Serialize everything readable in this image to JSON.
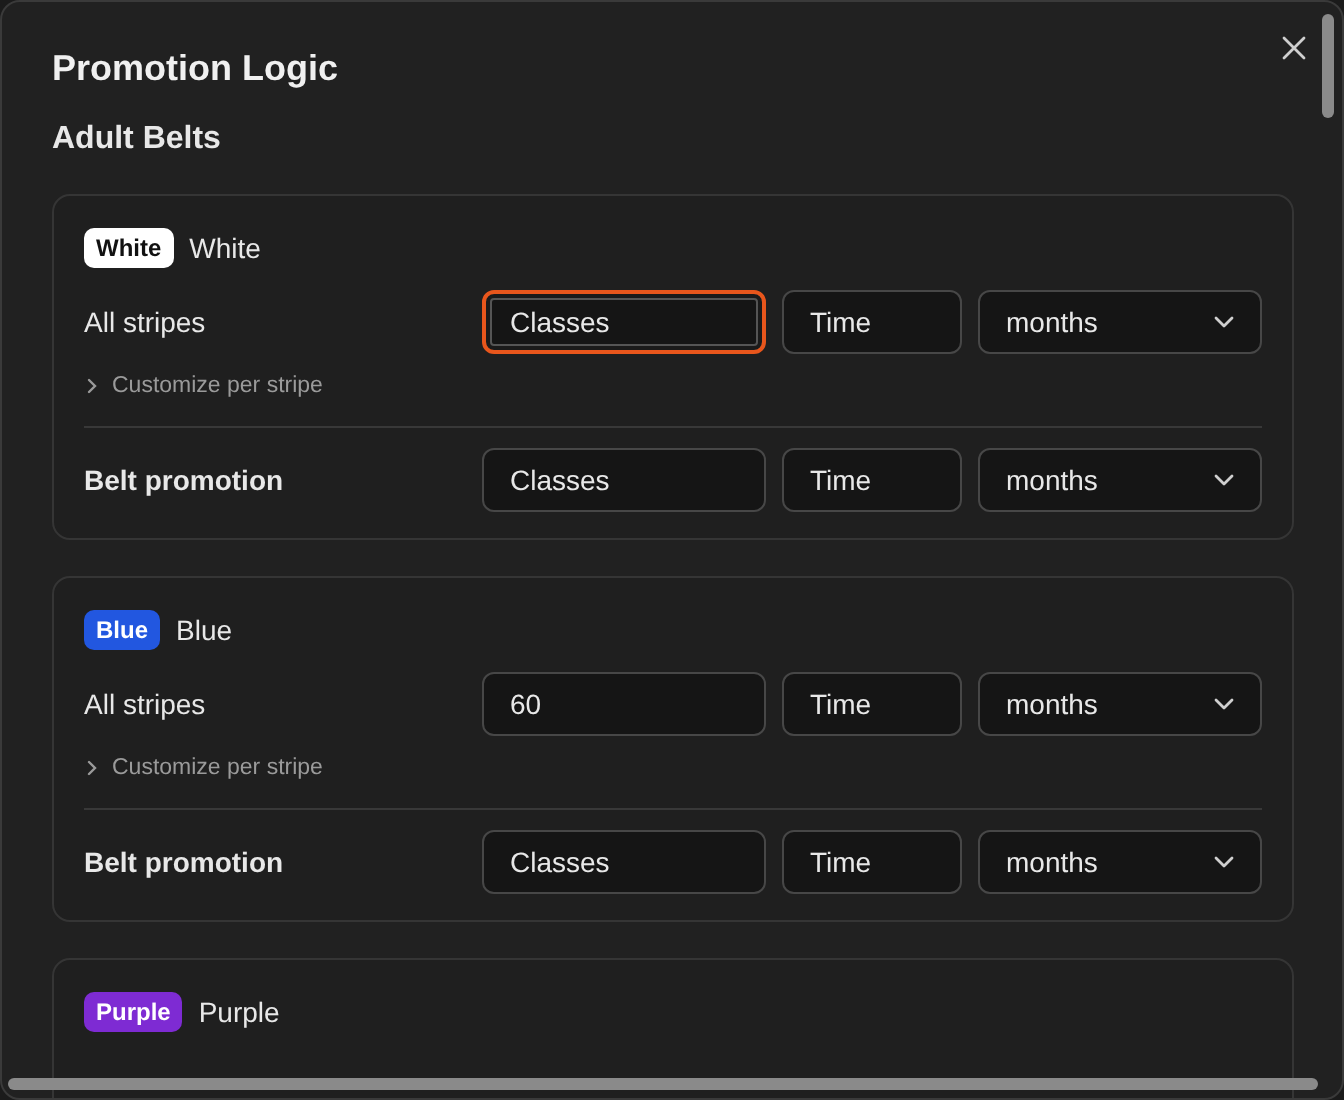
{
  "dialog": {
    "title": "Promotion Logic"
  },
  "section_title": "Adult Belts",
  "belts": [
    {
      "badge": "White",
      "color": "#ffffff",
      "name": "White",
      "rows": [
        {
          "kind": "stripes",
          "label": "All stripes",
          "count": {
            "placeholder": "Classes",
            "focused": true
          },
          "time": {
            "placeholder": "Time",
            "focused": false
          },
          "unit": {
            "value": "months"
          },
          "customize": {
            "label": "Customize per stripe",
            "expanded": false
          }
        },
        {
          "kind": "promotion",
          "label": "Belt promotion",
          "count": {
            "placeholder": "Classes",
            "focused": false
          },
          "time": {
            "placeholder": "Time",
            "focused": false
          },
          "unit": {
            "value": "months"
          }
        }
      ]
    },
    {
      "badge": "Blue",
      "color": "#2257e0",
      "name": "Blue",
      "rows": [
        {
          "kind": "stripes",
          "label": "All stripes",
          "count": {
            "value": "60",
            "focused": false
          },
          "time": {
            "placeholder": "Time",
            "focused": false
          },
          "unit": {
            "value": "months"
          },
          "customize": {
            "label": "Customize per stripe",
            "expanded": false
          }
        },
        {
          "kind": "promotion",
          "label": "Belt promotion",
          "count": {
            "placeholder": "Classes",
            "focused": false
          },
          "time": {
            "placeholder": "Time",
            "focused": false
          },
          "unit": {
            "value": "months"
          }
        }
      ]
    },
    {
      "badge": "Purple",
      "color": "#7e2bd3",
      "name": "Purple"
    }
  ]
}
